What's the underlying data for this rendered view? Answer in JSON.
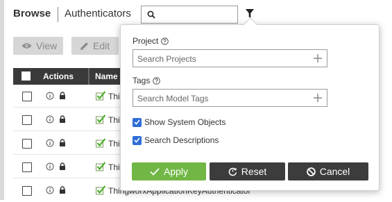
{
  "header": {
    "title": "Browse",
    "entity_type": "Authenticators",
    "search_value": ""
  },
  "toolbar": {
    "view_label": "View",
    "edit_label": "Edit"
  },
  "table": {
    "columns": [
      "Actions",
      "Name"
    ],
    "rows": [
      {
        "name": "Thin"
      },
      {
        "name": "Thin"
      },
      {
        "name": "Thin"
      },
      {
        "name": "Thin"
      },
      {
        "name": "ThingworxApplicationKeyAuthenticator"
      }
    ]
  },
  "filter_panel": {
    "project_label": "Project",
    "project_placeholder": "Search Projects",
    "tags_label": "Tags",
    "tags_placeholder": "Search Model Tags",
    "show_system_objects_label": "Show System Objects",
    "show_system_objects_checked": true,
    "search_descriptions_label": "Search Descriptions",
    "search_descriptions_checked": true,
    "apply_label": "Apply",
    "reset_label": "Reset",
    "cancel_label": "Cancel"
  },
  "colors": {
    "apply_button": "#72b745",
    "dark_button": "#3c3c3c",
    "checkbox_blue": "#2e6ed6",
    "table_header": "#3a3a3a"
  },
  "icons": [
    "search-icon",
    "filter-icon",
    "eye-icon",
    "pencil-icon",
    "info-icon",
    "lock-icon",
    "thing-icon",
    "help-icon",
    "plus-icon",
    "check-icon",
    "reset-icon",
    "cancel-icon"
  ]
}
